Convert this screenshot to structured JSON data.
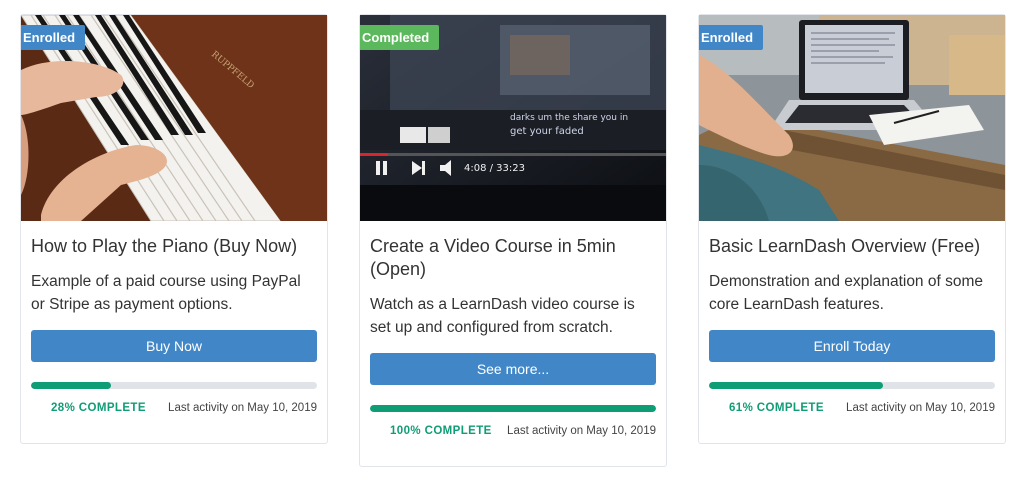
{
  "cards": [
    {
      "ribbon": "Enrolled",
      "ribbon_color": "#4187c8",
      "title": "How to Play the Piano (Buy Now)",
      "description": "Example of a paid course using PayPal or Stripe as payment options.",
      "button": "Buy Now",
      "progress_fraction": 0.28,
      "progress_text": "28% COMPLETE",
      "last_activity": "Last activity on May 10, 2019",
      "image": "piano-image"
    },
    {
      "ribbon": "Completed",
      "ribbon_color": "#5cb85c",
      "title": "Create a Video Course in 5min (Open)",
      "description": "Watch as a LearnDash video course is set up and configured from scratch.",
      "button": "See more...",
      "progress_fraction": 1.0,
      "progress_text": "100% COMPLETE",
      "last_activity": "Last activity on May 10, 2019",
      "image": "video-player-image",
      "video": {
        "time": "4:08 / 33:23",
        "caption_line1": "darks um the share you in",
        "caption_line2": "get your faded"
      }
    },
    {
      "ribbon": "Enrolled",
      "ribbon_color": "#4187c8",
      "title": "Basic LearnDash Overview (Free)",
      "description": "Demonstration and explanation of some core LearnDash features.",
      "button": "Enroll Today",
      "progress_fraction": 0.61,
      "progress_text": "61% COMPLETE",
      "last_activity": "Last activity on May 10, 2019",
      "image": "laptop-desk-image"
    }
  ],
  "colors": {
    "button": "#4187c8",
    "progress": "#0f9d75",
    "track": "#e0e4e9"
  }
}
